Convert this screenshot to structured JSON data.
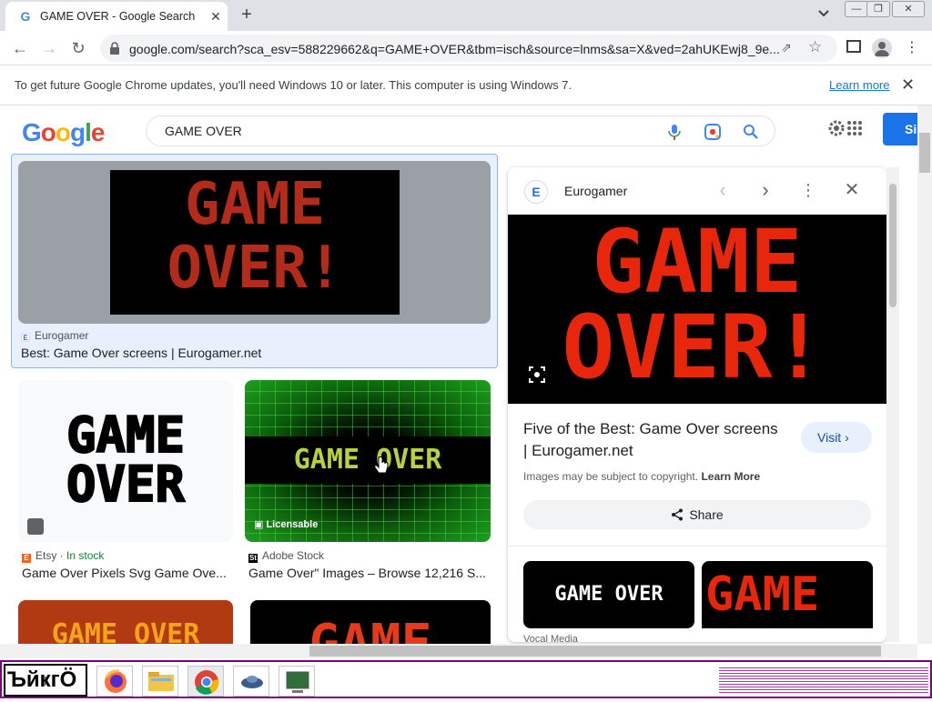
{
  "browser": {
    "tab_title": "GAME OVER - Google Search",
    "tab_favicon": "G",
    "url": "google.com/search?sca_esv=588229662&q=GAME+OVER&tbm=isch&source=lnms&sa=X&ved=2ahUKEwj8_9e...",
    "infobar_text": "To get future Google Chrome updates, you'll need Windows 10 or later. This computer is using Windows 7.",
    "infobar_link": "Learn more"
  },
  "google": {
    "logo": "Google",
    "query": "GAME OVER",
    "signin": "Si"
  },
  "results": [
    {
      "source": "Eurogamer",
      "title": "Best: Game Over screens | Eurogamer.net",
      "art_line1": "GAME",
      "art_line2": "OVER!"
    },
    {
      "source": "Etsy",
      "stock": "In stock",
      "title": "Game Over Pixels Svg Game Ove...",
      "art_line1": "GAME",
      "art_line2": "OVER"
    },
    {
      "source": "Adobe Stock",
      "badge": "Licensable",
      "title": "Game Over\" Images – Browse 12,216 S...",
      "art": "GAME OVER"
    },
    {
      "art": "GAME OVER"
    },
    {
      "art": "GAME"
    }
  ],
  "panel": {
    "source": "Eurogamer",
    "source_icon": "E",
    "art_line1": "GAME",
    "art_line2": "OVER!",
    "title": "Five of the Best: Game Over screens | Eurogamer.net",
    "visit": "Visit",
    "copyright": "Images may be subject to copyright.",
    "learn_more": "Learn More",
    "share": "Share",
    "related1": "GAME OVER",
    "related2": "GAME",
    "related_source": "Vocal Media"
  },
  "taskbar": {
    "start": "ЪйҝгӦ"
  },
  "colors": {
    "accent": "#1a73e8",
    "game_over_red": "#e8260c",
    "taskbar_border": "#7b0080"
  }
}
